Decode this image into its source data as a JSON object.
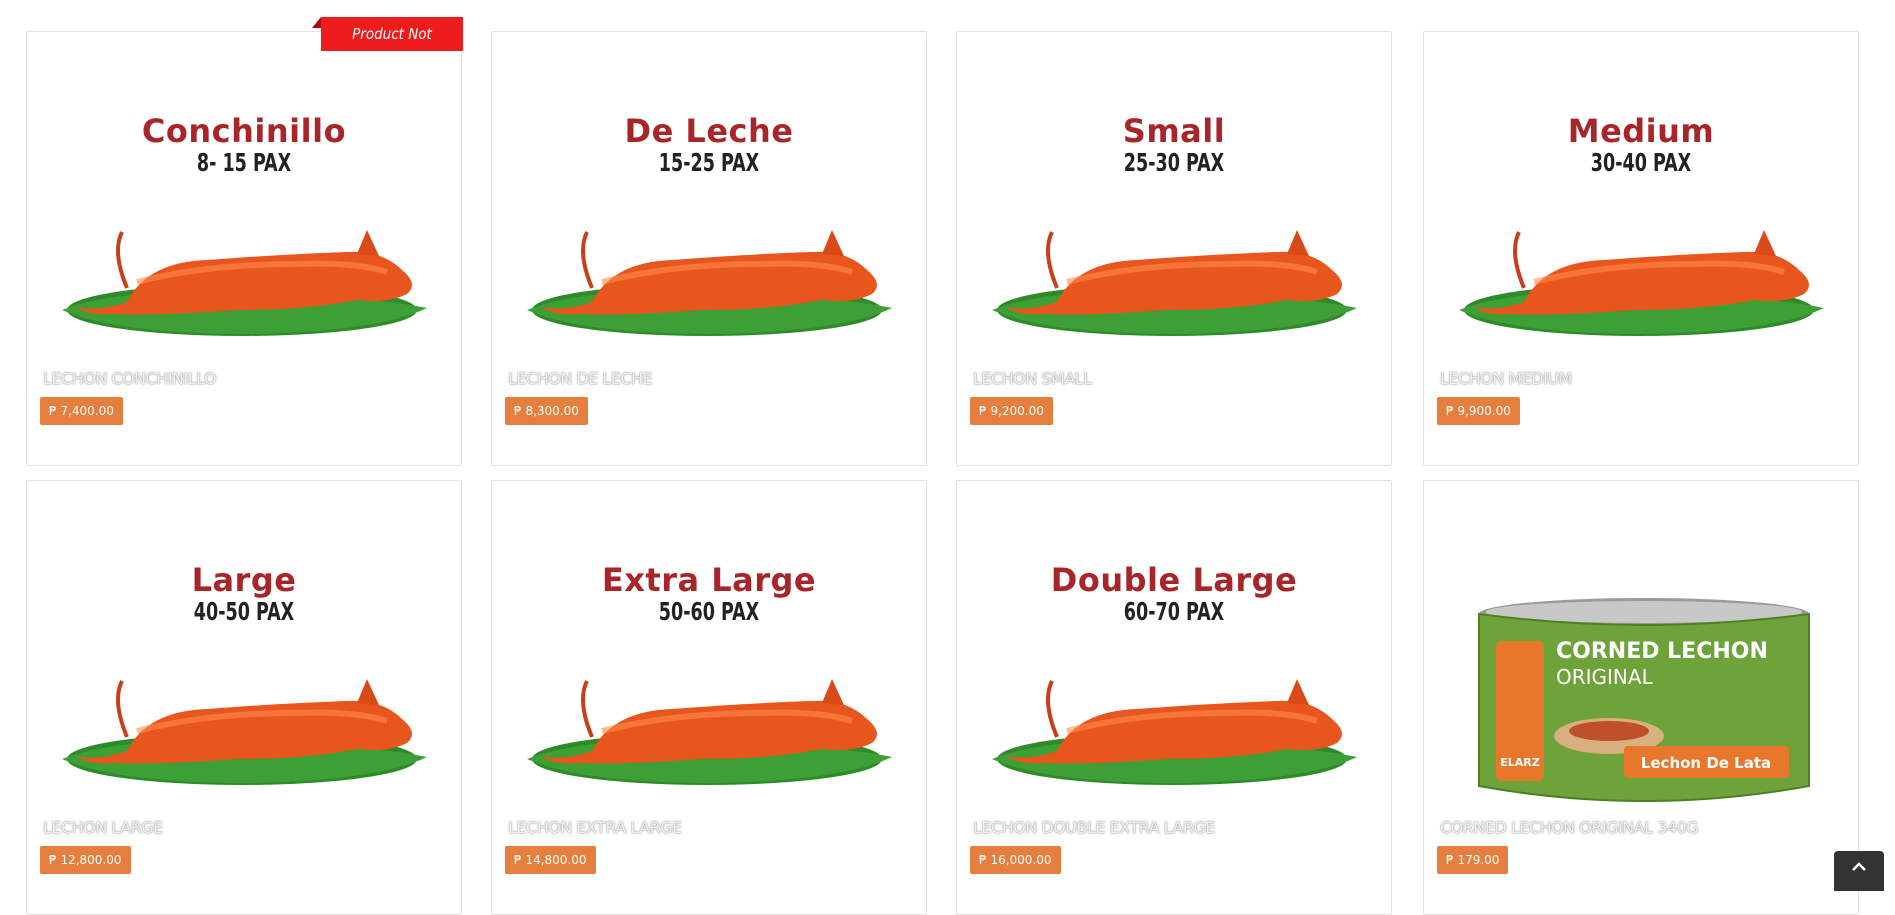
{
  "products": [
    {
      "size": "Conchinillo",
      "pax": "8- 15 PAX",
      "name": "LECHON CONCHINILLO",
      "price": "₱ 7,400.00",
      "badge": "Product Not Available!"
    },
    {
      "size": "De Leche",
      "pax": "15-25 PAX",
      "name": "LECHON DE LECHE",
      "price": "₱ 8,300.00"
    },
    {
      "size": "Small",
      "pax": "25-30 PAX",
      "name": "LECHON SMALL",
      "price": "₱ 9,200.00"
    },
    {
      "size": "Medium",
      "pax": "30-40 PAX",
      "name": "LECHON MEDIUM",
      "price": "₱ 9,900.00"
    },
    {
      "size": "Large",
      "pax": "40-50 PAX",
      "name": "LECHON LARGE",
      "price": "₱ 12,800.00"
    },
    {
      "size": "Extra Large",
      "pax": "50-60 PAX",
      "name": "LECHON EXTRA LARGE",
      "price": "₱ 14,800.00"
    },
    {
      "size": "Double Large",
      "pax": "60-70 PAX",
      "name": "LECHON DOUBLE EXTRA LARGE",
      "price": "₱ 16,000.00"
    },
    {
      "name": "CORNED LECHON ORIGINAL 340G",
      "price": "₱ 179.00",
      "can": {
        "title_line1": "CORNED LECHON",
        "title_line2": "ORIGINAL",
        "brand": "ELARZ",
        "subtitle": "Lechon De Lata"
      }
    }
  ],
  "colors": {
    "accent": "#e67e3d",
    "title_red": "#a8262a",
    "badge_red": "#ee1c1c"
  },
  "scroll_top_icon": "chevron-up-icon"
}
